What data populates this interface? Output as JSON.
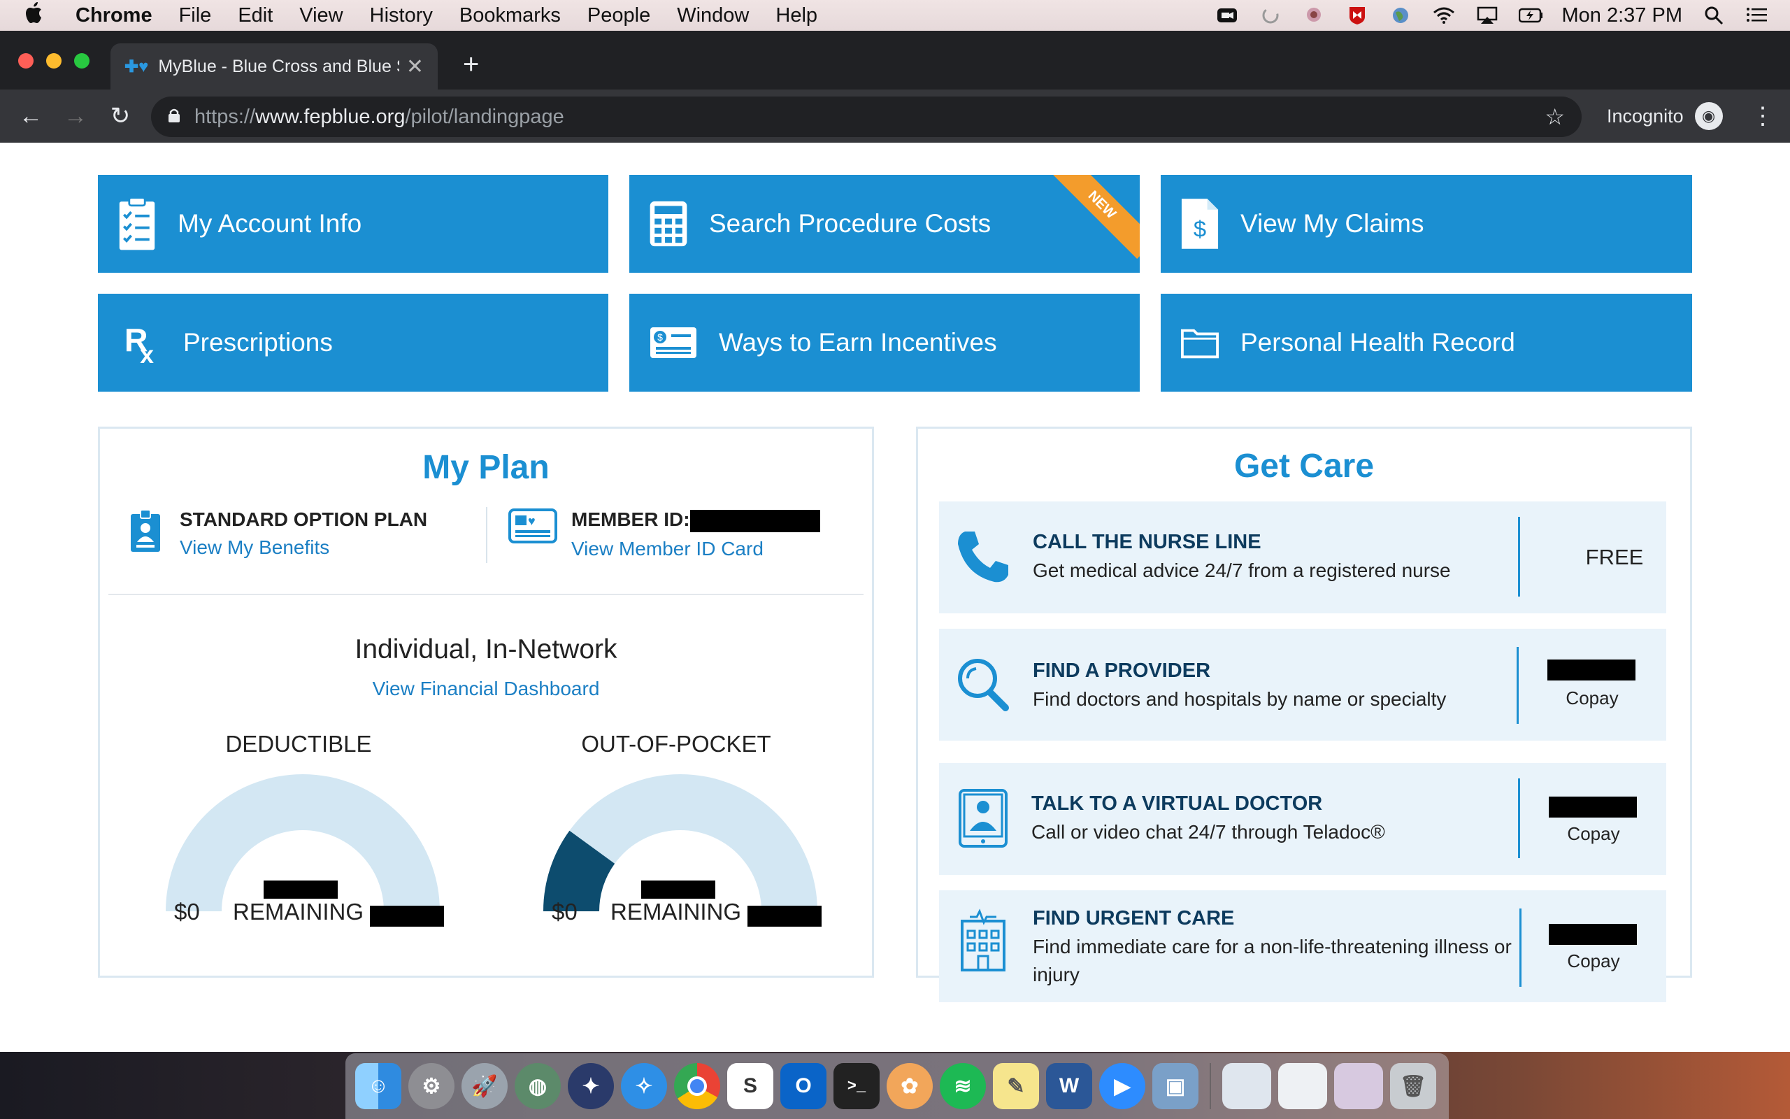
{
  "menubar": {
    "apple": "",
    "app_name": "Chrome",
    "items": [
      "File",
      "Edit",
      "View",
      "History",
      "Bookmarks",
      "People",
      "Window",
      "Help"
    ],
    "clock": "Mon 2:37 PM"
  },
  "browser": {
    "tab_title": "MyBlue - Blue Cross and Blue S",
    "url_scheme": "https://",
    "url_host": "www.fepblue.org",
    "url_path": "/pilot/landingpage",
    "profile_label": "Incognito"
  },
  "tiles": [
    {
      "label": "My Account Info",
      "icon": "clipboard-checklist-icon"
    },
    {
      "label": "Search Procedure Costs",
      "icon": "calculator-icon",
      "ribbon": "NEW"
    },
    {
      "label": "View My Claims",
      "icon": "dollar-document-icon"
    },
    {
      "label": "Prescriptions",
      "icon": "rx-icon"
    },
    {
      "label": "Ways to Earn Incentives",
      "icon": "cash-card-icon"
    },
    {
      "label": "Personal Health Record",
      "icon": "folder-icon"
    }
  ],
  "my_plan": {
    "title": "My Plan",
    "plan_name": "STANDARD OPTION PLAN",
    "benefits_link": "View My Benefits",
    "member_id_label": "MEMBER ID:",
    "member_id_card_link": "View Member ID Card",
    "network": "Individual, In-Network",
    "financial_link": "View Financial Dashboard",
    "deductible": {
      "title": "DEDUCTIBLE",
      "start": "$0",
      "remaining_label": "REMAINING",
      "fill_fraction": 0.0
    },
    "out_of_pocket": {
      "title": "OUT-OF-POCKET",
      "start": "$0",
      "remaining_label": "REMAINING",
      "fill_fraction": 0.2
    }
  },
  "get_care": {
    "title": "Get Care",
    "items": [
      {
        "title": "CALL THE NURSE LINE",
        "desc": "Get medical advice 24/7 from a registered nurse",
        "cost": "FREE",
        "icon": "phone-icon"
      },
      {
        "title": "FIND A PROVIDER",
        "desc": "Find doctors and hospitals by name or specialty",
        "cost": "Copay",
        "icon": "magnifier-icon"
      },
      {
        "title": "TALK TO A VIRTUAL DOCTOR",
        "desc": "Call or video chat 24/7 through Teladoc®",
        "cost": "Copay",
        "icon": "tablet-doctor-icon"
      },
      {
        "title": "FIND URGENT CARE",
        "desc": "Find immediate care for a non-life-threatening illness or injury",
        "cost": "Copay",
        "icon": "hospital-icon"
      }
    ]
  },
  "colors": {
    "tile_blue": "#1b8fd2",
    "ribbon_orange": "#f39c2c",
    "gauge_track": "#d3e7f3",
    "gauge_fill": "#0d4c6e"
  }
}
